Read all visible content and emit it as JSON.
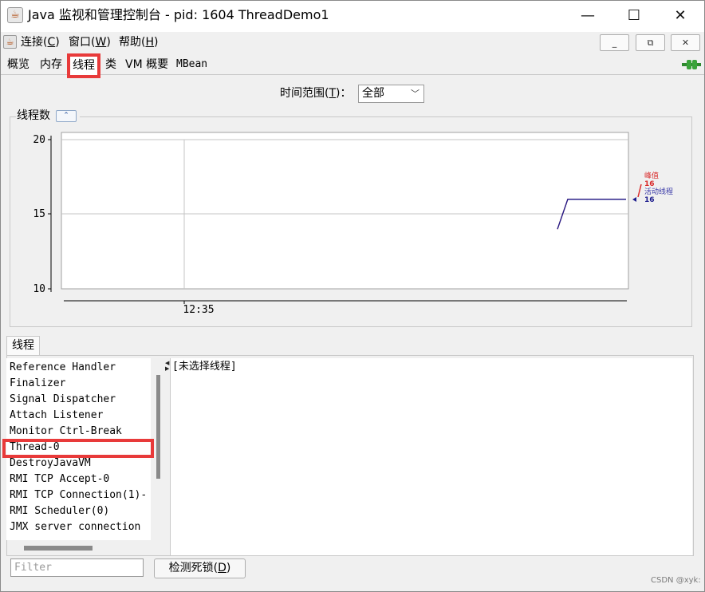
{
  "window": {
    "title": "Java 监视和管理控制台 - pid: 1604 ThreadDemo1",
    "app_icon": "java-coffee-icon",
    "minimize_glyph": "—",
    "maximize_glyph": "☐",
    "close_glyph": "✕"
  },
  "menu": {
    "items": [
      {
        "label_main": "连接(",
        "mnemonic": "C",
        "label_end": ")"
      },
      {
        "label_main": "窗口(",
        "mnemonic": "W",
        "label_end": ")"
      },
      {
        "label_main": "帮助(",
        "mnemonic": "H",
        "label_end": ")"
      }
    ],
    "mdi_minimize": "_",
    "mdi_restore": "⧉",
    "mdi_close": "✕"
  },
  "tabs": [
    "概览",
    "内存",
    "线程",
    "类",
    "VM 概要",
    "MBean"
  ],
  "active_tab": "线程",
  "time_range": {
    "label_main": "时间范围(",
    "mnemonic": "T",
    "label_end": ")：",
    "value": "全部"
  },
  "chart_panel": {
    "title": "线程数",
    "collapse_glyph": "⌃"
  },
  "chart_data": {
    "type": "line",
    "ylim": [
      10,
      20
    ],
    "y_ticks": [
      "20",
      "15",
      "10"
    ],
    "x_tick": "12:35",
    "series": [
      {
        "name": "峰值",
        "latest": "16",
        "color": "#d92a2a",
        "points": [
          [
            0.0,
            14
          ],
          [
            0.15,
            16
          ],
          [
            1.0,
            16
          ]
        ]
      },
      {
        "name": "活动线程",
        "latest": "16",
        "color": "#1a1a8c",
        "points": [
          [
            0.0,
            14
          ],
          [
            0.15,
            16
          ],
          [
            1.0,
            16
          ]
        ]
      }
    ]
  },
  "threads_tab": "线程",
  "thread_list": [
    "Reference Handler",
    "Finalizer",
    "Signal Dispatcher",
    "Attach Listener",
    "Monitor Ctrl-Break",
    "Thread-0",
    "DestroyJavaVM",
    "RMI TCP Accept-0",
    "RMI TCP Connection(1)-",
    "RMI Scheduler(0)",
    "JMX server connection"
  ],
  "selected_thread": "Thread-0",
  "detail_text": "[未选择线程]",
  "filter": {
    "placeholder": "Filter"
  },
  "detect_deadlock": {
    "label_main": "检测死锁(",
    "mnemonic": "D",
    "label_end": ")"
  },
  "watermark": "CSDN @xyk:"
}
